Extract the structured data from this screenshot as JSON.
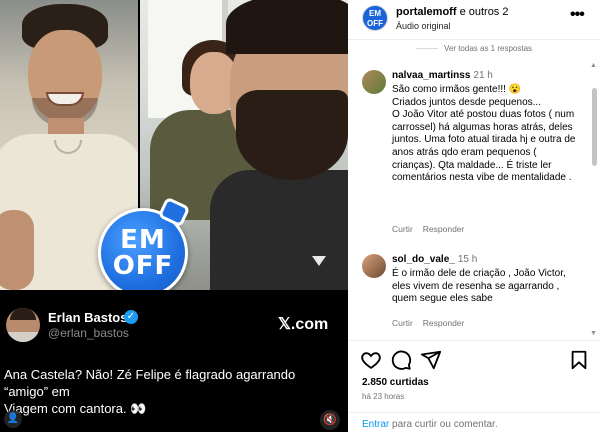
{
  "media": {
    "badge": {
      "line1": "EM",
      "line2": "OFF"
    },
    "tweet": {
      "name": "Erlan Bastos",
      "handle": "@erlan_bastos",
      "platform_logo": "𝕏.com",
      "text_lines": [
        "Ana Castela? Não! Zé Felipe é flagrado agarrando",
        "“amigo” em",
        "Viagem com cantora. 👀"
      ]
    }
  },
  "header": {
    "owner": "portalemoff",
    "others": "e outros 2",
    "audio": "Áudio original",
    "avatar_text": "EM OFF",
    "more_icon": "more-icon"
  },
  "thread": {
    "replies_label": "Ver todas as 1 respostas"
  },
  "comments": [
    {
      "user": "nalvaa_martinss",
      "time": "21 h",
      "text": "São como irmãos gente!!! 😮\nCriados juntos desde pequenos...\nO João Vitor até postou duas fotos ( num carrossel) há algumas horas atrás, deles juntos. Uma foto atual tirada hj e outra de anos atrás qdo eram pequenos ( crianças). Qta maldade... É triste ler comentários nesta vibe de mentalidade .",
      "reply_label": "Responder",
      "like_label": "Curtir"
    },
    {
      "user": "sol_do_vale_",
      "time": "15 h",
      "text": "É o irmão dele de criação , João Victor, eles vivem de resenha se agarrando , quem segue eles sabe",
      "reply_label": "Responder",
      "like_label": "Curtir"
    }
  ],
  "post": {
    "likes": "2.850 curtidas",
    "date": "há 23 horas"
  },
  "footer": {
    "login_link": "Entrar",
    "login_rest": " para curtir ou comentar."
  },
  "colors": {
    "link": "#0095f6",
    "badge": "#1f6fe0",
    "verified": "#1d9bf0"
  }
}
